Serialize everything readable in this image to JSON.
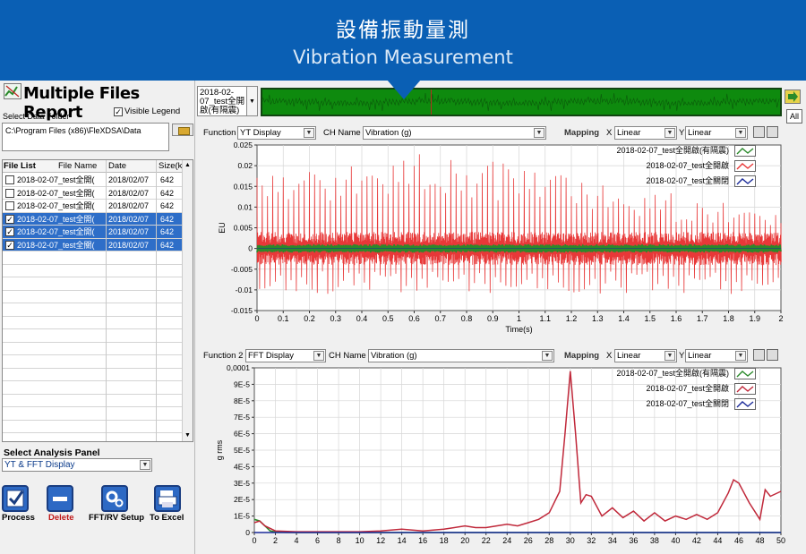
{
  "banner": {
    "title_zh": "設備振動量測",
    "title_en": "Vibration Measurement",
    "color": "#0a5fb4"
  },
  "left_panel": {
    "report_title": "Multiple Files Report",
    "visible_legend_label": "Visible Legend",
    "visible_legend_checked": true,
    "select_folder_label": "Select Data Folder",
    "folder_path": "C:\\Program Files (x86)\\FleXDSA\\Data",
    "file_list": {
      "headers": [
        "File List",
        "File Name",
        "Date",
        "Size(k"
      ],
      "rows": [
        {
          "name": "2018-02-07_test全開(",
          "date": "2018/02/07",
          "size": "642",
          "checked": false,
          "selected": false
        },
        {
          "name": "2018-02-07_test全開(",
          "date": "2018/02/07",
          "size": "642",
          "checked": false,
          "selected": false
        },
        {
          "name": "2018-02-07_test全開(",
          "date": "2018/02/07",
          "size": "642",
          "checked": false,
          "selected": false
        },
        {
          "name": "2018-02-07_test全開(",
          "date": "2018/02/07",
          "size": "642",
          "checked": true,
          "selected": true
        },
        {
          "name": "2018-02-07_test全開(",
          "date": "2018/02/07",
          "size": "642",
          "checked": true,
          "selected": true
        },
        {
          "name": "2018-02-07_test全關(",
          "date": "2018/02/07",
          "size": "642",
          "checked": true,
          "selected": true
        }
      ]
    },
    "analysis_panel_label": "Select Analysis Panel",
    "analysis_panel_value": "YT & FFT Display",
    "toolbar": {
      "process": "Process",
      "delete": "Delete",
      "fft_setup": "FFT/RV Setup",
      "to_excel": "To Excel"
    }
  },
  "top_bar": {
    "file_select_value": "2018-02-07_test全開 啟(有隔震)",
    "all_button": "All"
  },
  "chart1_controls": {
    "function_label": "Function",
    "function_value": "YT Display",
    "ch_name_label": "CH Name",
    "ch_name_value": "Vibration (g)",
    "mapping_label": "Mapping",
    "x_label": "X",
    "x_value": "Linear",
    "y_label": "Y",
    "y_value": "Linear"
  },
  "chart2_controls": {
    "function_label": "Function 2",
    "function_value": "FFT Display",
    "ch_name_label": "CH Name",
    "ch_name_value": "Vibration (g)",
    "mapping_label": "Mapping",
    "x_label": "X",
    "x_value": "Linear",
    "y_label": "Y",
    "y_value": "Linear"
  },
  "chart_data": [
    {
      "type": "line",
      "xlabel": "Time(s)",
      "ylabel": "EU",
      "xlim": [
        0,
        2
      ],
      "ylim": [
        -0.015,
        0.025
      ],
      "x_ticks": [
        "0",
        "0.1",
        "0.2",
        "0.3",
        "0.4",
        "0.5",
        "0.6",
        "0.7",
        "0.8",
        "0.9",
        "1",
        "1.1",
        "1.2",
        "1.3",
        "1.4",
        "1.5",
        "1.6",
        "1.7",
        "1.8",
        "1.9",
        "2"
      ],
      "y_ticks": [
        "0.025",
        "0.02",
        "0.015",
        "0.01",
        "0.005",
        "0",
        "-0.005",
        "-0.01",
        "-0.015"
      ],
      "legend_placement": "top-right",
      "grid": true,
      "series": [
        {
          "name": "2018-02-07_test全開啟(有隔震)",
          "color": "#2b8a2b",
          "amplitude": 0.001
        },
        {
          "name": "2018-02-07_test全開啟",
          "color": "#e83838",
          "peak_envelope": [
            0.018,
            0.02,
            0.022,
            0.023,
            0.021,
            0.02,
            0.016,
            0.014,
            0.011,
            0.009,
            0.009
          ],
          "amplitude_base": 0.004
        },
        {
          "name": "2018-02-07_test全關閉",
          "color": "#1a2a99",
          "amplitude": 0.0005
        }
      ]
    },
    {
      "type": "line",
      "xlabel": "",
      "ylabel": "g rms",
      "xlim": [
        0,
        50
      ],
      "ylim": [
        0,
        0.0001
      ],
      "x_ticks": [
        "0",
        "2",
        "4",
        "6",
        "8",
        "10",
        "12",
        "14",
        "16",
        "18",
        "20",
        "22",
        "24",
        "26",
        "28",
        "30",
        "32",
        "34",
        "36",
        "38",
        "40",
        "42",
        "44",
        "46",
        "48",
        "50"
      ],
      "y_ticks": [
        "0,0001",
        "9E-5",
        "8E-5",
        "7E-5",
        "6E-5",
        "5E-5",
        "4E-5",
        "3E-5",
        "2E-5",
        "1E-5",
        "0"
      ],
      "legend_placement": "top-right",
      "grid": true,
      "series": [
        {
          "name": "2018-02-07_test全開啟(有隔震)",
          "color": "#2b8a2b",
          "x": [
            0,
            0.5,
            1,
            1.5,
            2,
            3,
            4,
            50
          ],
          "y": [
            8e-06,
            7e-06,
            4e-06,
            1e-06,
            3e-07,
            1e-07,
            0,
            0
          ]
        },
        {
          "name": "2018-02-07_test全開啟",
          "color": "#c0283a",
          "x": [
            0,
            0.5,
            1,
            2,
            4,
            6,
            8,
            10,
            12,
            14,
            16,
            18,
            20,
            21,
            22,
            23,
            24,
            25,
            26,
            27,
            28,
            29,
            29.5,
            30,
            30.5,
            31,
            31.5,
            32,
            33,
            34,
            35,
            36,
            37,
            38,
            39,
            40,
            41,
            42,
            43,
            44,
            45,
            45.5,
            46,
            47,
            48,
            48.5,
            49,
            50
          ],
          "y": [
            6e-06,
            7e-06,
            4e-06,
            1e-06,
            5e-07,
            5e-07,
            5e-07,
            5e-07,
            1e-06,
            2e-06,
            1e-06,
            2e-06,
            4e-06,
            3e-06,
            3e-06,
            4e-06,
            5e-06,
            4e-06,
            6e-06,
            8e-06,
            1.2e-05,
            2.5e-05,
            6e-05,
            9.8e-05,
            6e-05,
            1.8e-05,
            2.3e-05,
            2.2e-05,
            1e-05,
            1.5e-05,
            9e-06,
            1.3e-05,
            7e-06,
            1.2e-05,
            7e-06,
            1e-05,
            8e-06,
            1.1e-05,
            8e-06,
            1.2e-05,
            2.4e-05,
            3.2e-05,
            3e-05,
            1.8e-05,
            8e-06,
            2.6e-05,
            2.2e-05,
            2.5e-05
          ]
        },
        {
          "name": "2018-02-07_test全關閉",
          "color": "#1a2a99",
          "x": [
            0,
            50
          ],
          "y": [
            0,
            0
          ]
        }
      ]
    }
  ]
}
